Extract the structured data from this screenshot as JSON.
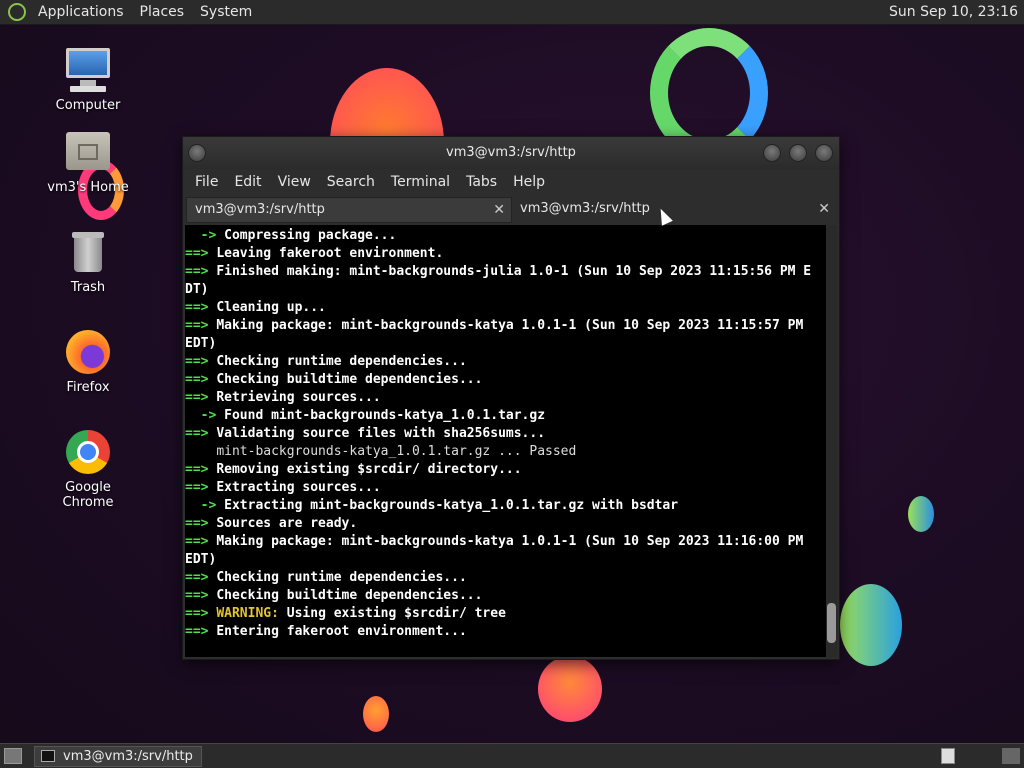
{
  "top_panel": {
    "menus": [
      "Applications",
      "Places",
      "System"
    ],
    "clock": "Sun Sep 10, 23:16"
  },
  "desktop_icons": [
    {
      "label": "Computer",
      "icon": "computer-icon"
    },
    {
      "label": "vm3's Home",
      "icon": "home-folder-icon"
    },
    {
      "label": "Trash",
      "icon": "trash-icon"
    },
    {
      "label": "Firefox",
      "icon": "firefox-icon"
    },
    {
      "label": "Google Chrome",
      "icon": "chrome-icon"
    }
  ],
  "terminal": {
    "title": "vm3@vm3:/srv/http",
    "menus": [
      "File",
      "Edit",
      "View",
      "Search",
      "Terminal",
      "Tabs",
      "Help"
    ],
    "tabs": [
      {
        "label": "vm3@vm3:/srv/http",
        "active": false
      },
      {
        "label": "vm3@vm3:/srv/http",
        "active": true
      }
    ],
    "lines": [
      {
        "prefix": "  -> ",
        "text": "Compressing package...",
        "kind": "arrow"
      },
      {
        "prefix": "==> ",
        "text": "Leaving fakeroot environment.",
        "kind": "main"
      },
      {
        "prefix": "==> ",
        "text": "Finished making: mint-backgrounds-julia 1.0-1 (Sun 10 Sep 2023 11:15:56 PM E",
        "kind": "main"
      },
      {
        "prefix": "",
        "text": "DT)",
        "kind": "cont"
      },
      {
        "prefix": "==> ",
        "text": "Cleaning up...",
        "kind": "main"
      },
      {
        "prefix": "==> ",
        "text": "Making package: mint-backgrounds-katya 1.0.1-1 (Sun 10 Sep 2023 11:15:57 PM",
        "kind": "main"
      },
      {
        "prefix": "",
        "text": "EDT)",
        "kind": "cont"
      },
      {
        "prefix": "==> ",
        "text": "Checking runtime dependencies...",
        "kind": "main"
      },
      {
        "prefix": "==> ",
        "text": "Checking buildtime dependencies...",
        "kind": "main"
      },
      {
        "prefix": "==> ",
        "text": "Retrieving sources...",
        "kind": "main"
      },
      {
        "prefix": "  -> ",
        "text": "Found mint-backgrounds-katya_1.0.1.tar.gz",
        "kind": "arrow"
      },
      {
        "prefix": "==> ",
        "text": "Validating source files with sha256sums...",
        "kind": "main"
      },
      {
        "prefix": "    ",
        "text": "mint-backgrounds-katya_1.0.1.tar.gz ... Passed",
        "kind": "plain"
      },
      {
        "prefix": "==> ",
        "text": "Removing existing $srcdir/ directory...",
        "kind": "main"
      },
      {
        "prefix": "==> ",
        "text": "Extracting sources...",
        "kind": "main"
      },
      {
        "prefix": "  -> ",
        "text": "Extracting mint-backgrounds-katya_1.0.1.tar.gz with bsdtar",
        "kind": "arrow"
      },
      {
        "prefix": "==> ",
        "text": "Sources are ready.",
        "kind": "main"
      },
      {
        "prefix": "==> ",
        "text": "Making package: mint-backgrounds-katya 1.0.1-1 (Sun 10 Sep 2023 11:16:00 PM",
        "kind": "main"
      },
      {
        "prefix": "",
        "text": "EDT)",
        "kind": "cont"
      },
      {
        "prefix": "==> ",
        "text": "Checking runtime dependencies...",
        "kind": "main"
      },
      {
        "prefix": "==> ",
        "text": "Checking buildtime dependencies...",
        "kind": "main"
      },
      {
        "prefix": "==> ",
        "warn": "WARNING:",
        "text": " Using existing $srcdir/ tree",
        "kind": "warn"
      },
      {
        "prefix": "==> ",
        "text": "Entering fakeroot environment...",
        "kind": "main"
      }
    ]
  },
  "taskbar": {
    "item": "vm3@vm3:/srv/http"
  },
  "colors": {
    "arrow_green": "#4ce04c",
    "warning_yellow": "#e4c430"
  }
}
